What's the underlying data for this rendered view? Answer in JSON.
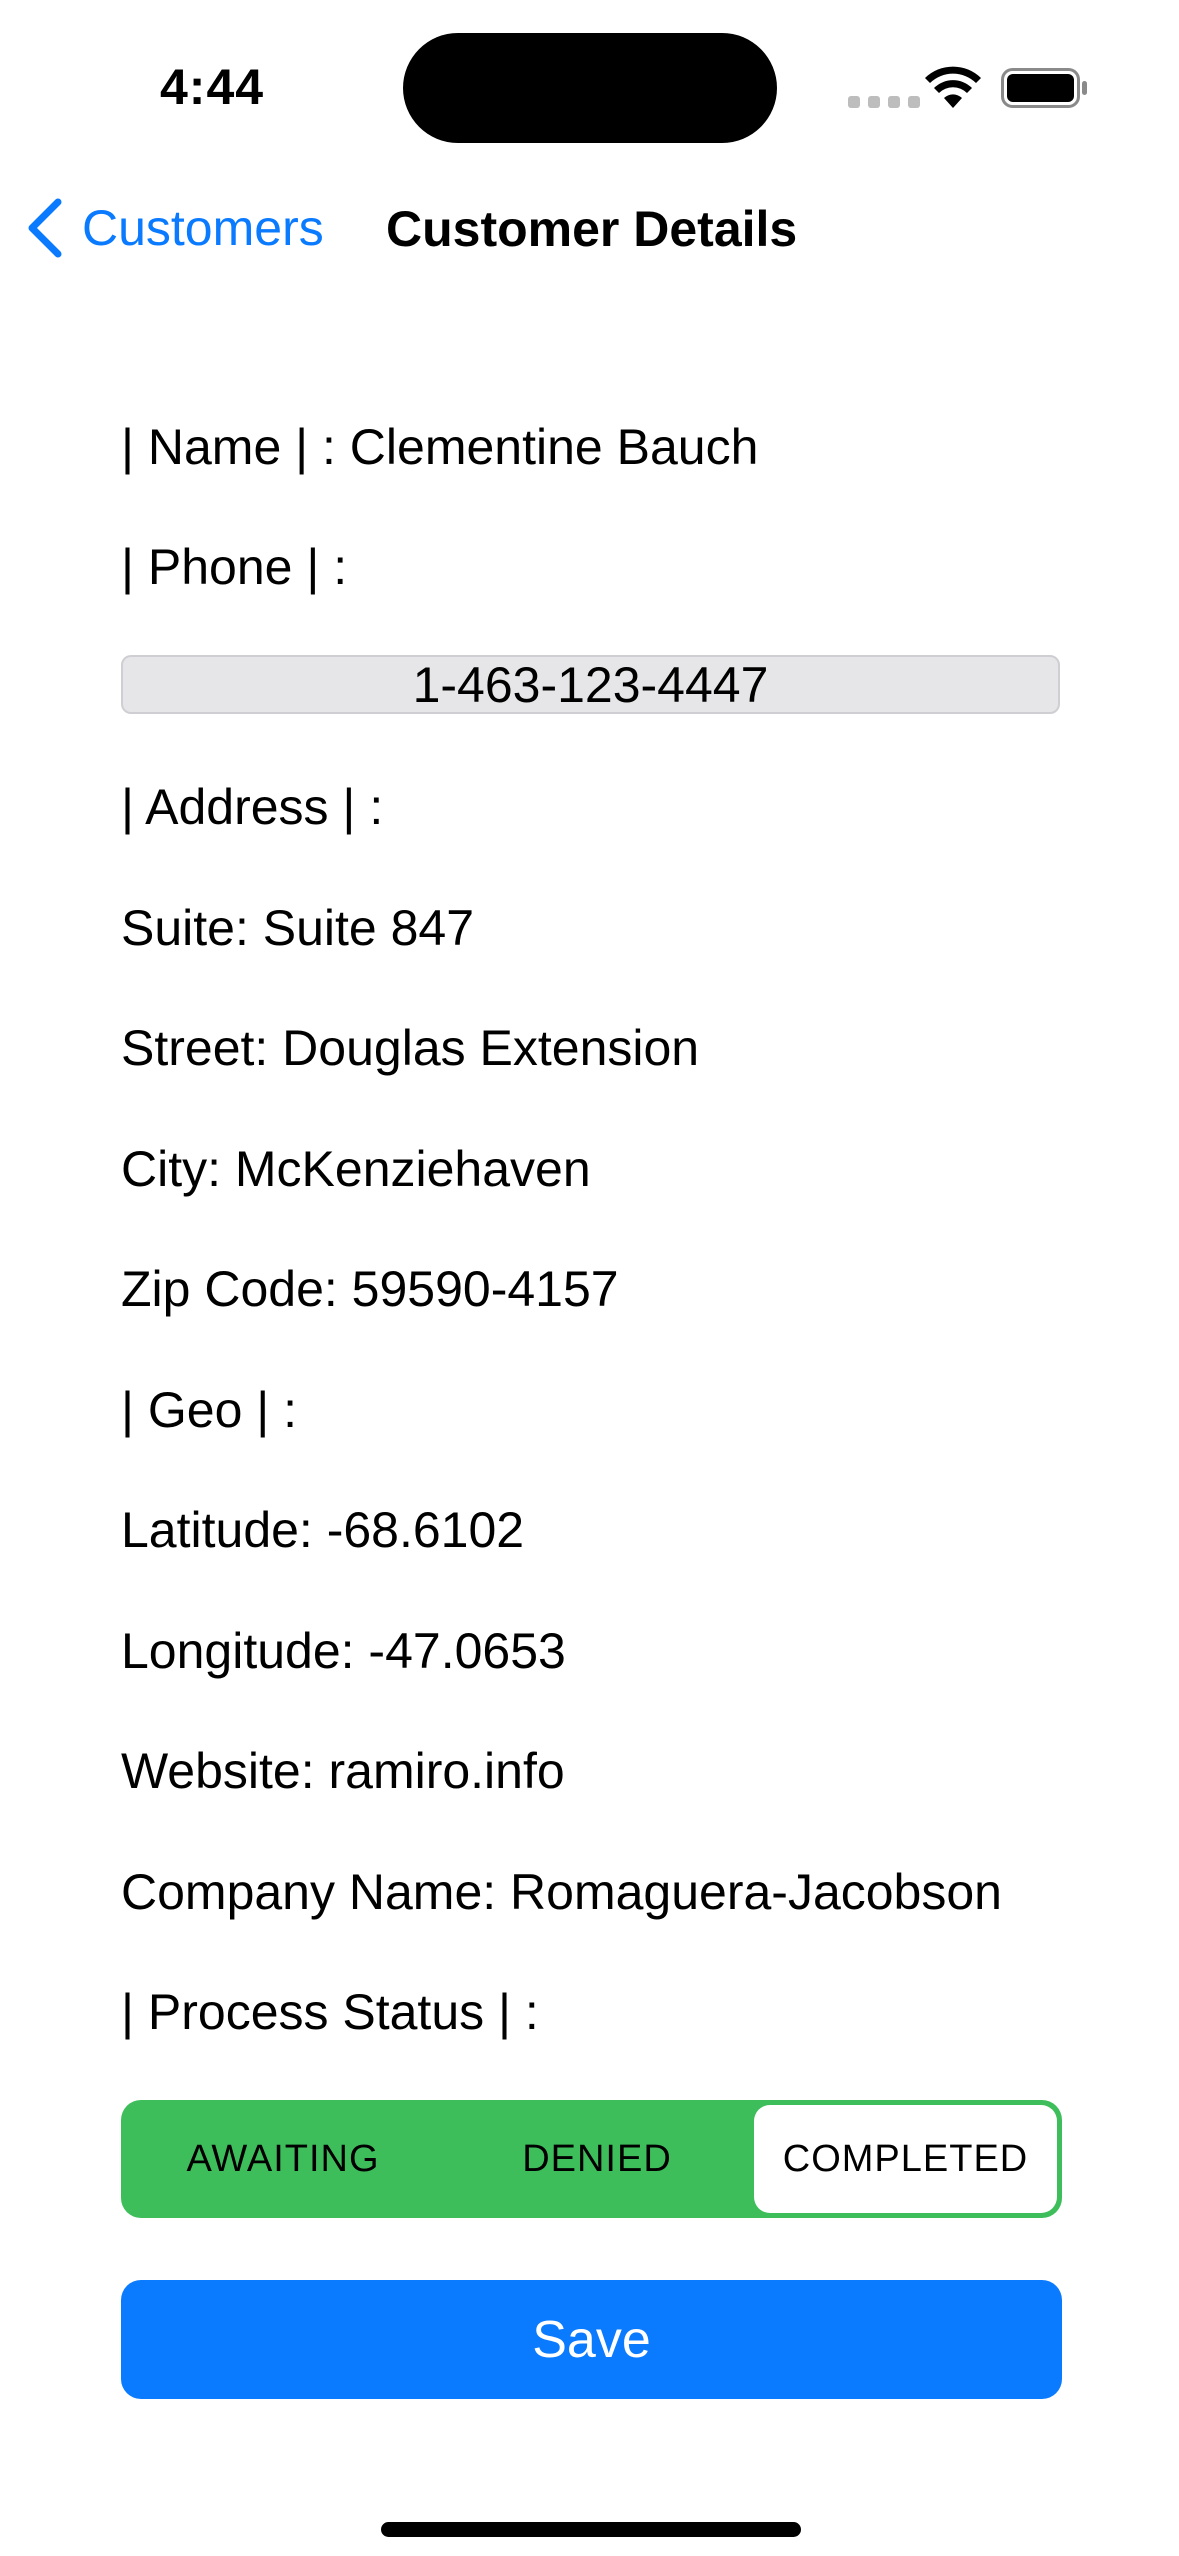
{
  "status_bar": {
    "time": "4:44",
    "icons": [
      "cellular-signal-icon",
      "wifi-icon",
      "battery-icon"
    ]
  },
  "nav": {
    "back_label": "Customers",
    "title": "Customer Details",
    "accent_color": "#0a7aff"
  },
  "details": {
    "name": "| Name | : Clementine Bauch",
    "phone_label": "| Phone | :",
    "phone_value": "1-463-123-4447",
    "address_label": "| Address | :",
    "suite": "Suite: Suite 847",
    "street": "Street: Douglas Extension",
    "city": "City: McKenziehaven",
    "zip": "Zip Code: 59590-4157",
    "geo_label": "| Geo | :",
    "latitude": "Latitude: -68.6102",
    "longitude": "Longitude: -47.0653",
    "website": "Website: ramiro.info",
    "company": "Company Name: Romaguera-Jacobson",
    "process_status_label": "| Process Status | :"
  },
  "status_control": {
    "options": [
      "AWAITING",
      "DENIED",
      "COMPLETED"
    ],
    "selected": "COMPLETED",
    "color": "#3dbe5b"
  },
  "save_button": {
    "label": "Save",
    "color": "#0a7aff"
  }
}
